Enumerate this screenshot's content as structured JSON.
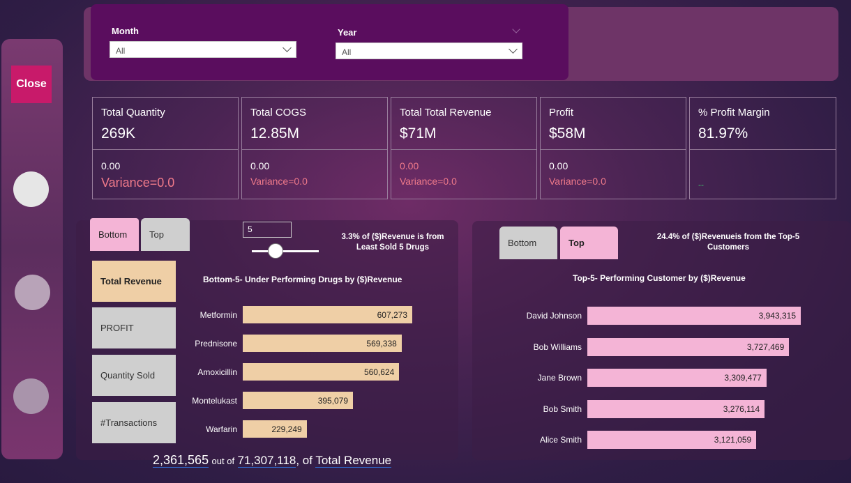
{
  "nav": {
    "close_label": "Close"
  },
  "filters": {
    "month_label": "Month",
    "month_value": "All",
    "year_label": "Year",
    "year_value": "All"
  },
  "kpis": [
    {
      "title": "Total Quantity",
      "value": "269K",
      "sub": "0.00",
      "variance": "Variance=0.0"
    },
    {
      "title": "Total COGS",
      "value": "12.85M",
      "sub": "0.00",
      "variance": "Variance=0.0"
    },
    {
      "title": "Total Total Revenue",
      "value": "$71M",
      "sub": "0.00",
      "variance": "Variance=0.0"
    },
    {
      "title": "Profit",
      "value": "$58M",
      "sub": "0.00",
      "variance": "Variance=0.0"
    },
    {
      "title": "% Profit Margin",
      "value": "81.97%",
      "sub": "",
      "variance": "--"
    }
  ],
  "left_panel": {
    "tab_bottom": "Bottom",
    "tab_top": "Top",
    "topn_value": "5",
    "note": "3.3% of ($)Revenue is from Least Sold 5 Drugs",
    "measures": [
      "Total Revenue",
      "PROFIT",
      "Quantity Sold",
      "#Transactions"
    ],
    "selected_measure": "Total Revenue",
    "slider_level": 0.35,
    "footer": {
      "part": "2,361,565",
      "out_of": "out of",
      "total": "71,307,118",
      "suffix": ", of",
      "measure": "Total Revenue"
    }
  },
  "right_panel": {
    "tab_bottom": "Bottom",
    "tab_top": "Top",
    "note": "24.4% of ($)Revenueis from the Top-5 Customers"
  },
  "chart_data": [
    {
      "type": "bar",
      "orientation": "horizontal",
      "title": "Bottom-5- Under Performing Drugs by ($)Revenue",
      "categories": [
        "Metformin",
        "Prednisone",
        "Amoxicillin",
        "Montelukast",
        "Warfarin"
      ],
      "values": [
        607273,
        569338,
        560624,
        395079,
        229249
      ],
      "value_labels": [
        "607,273",
        "569,338",
        "560,624",
        "395,079",
        "229,249"
      ],
      "color": "#efcfa6"
    },
    {
      "type": "bar",
      "orientation": "horizontal",
      "title": "Top-5- Performing Customer by ($)Revenue",
      "categories": [
        "David Johnson",
        "Bob Williams",
        "Jane Brown",
        "Bob Smith",
        "Alice Smith"
      ],
      "values": [
        3943315,
        3727469,
        3309477,
        3276114,
        3121059
      ],
      "value_labels": [
        "3,943,315",
        "3,727,469",
        "3,309,477",
        "3,276,114",
        "3,121,059"
      ],
      "color": "#f4b4d6"
    }
  ]
}
